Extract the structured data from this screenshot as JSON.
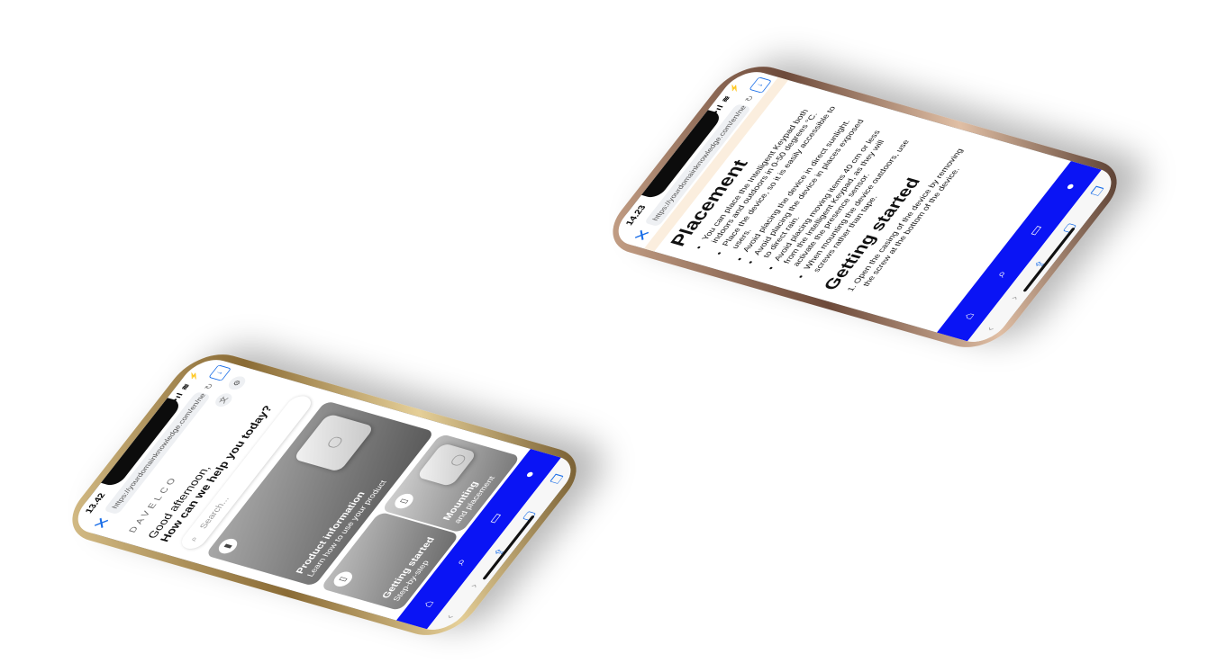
{
  "left_phone": {
    "time": "13.42",
    "status_icons": "•ıl ≋ ⚡",
    "url": "https://yourdomainknowledge.com/en/new-",
    "brand_text": "DAVELCO",
    "greeting_line1": "Good afternoon,",
    "greeting_line2": "How can we help you today?",
    "search_placeholder": "Search...",
    "cards": [
      {
        "title": "Product information",
        "subtitle": "Learn how to use your product"
      },
      {
        "title": "Mounting",
        "subtitle": "and placement"
      },
      {
        "title": "Getting started",
        "subtitle": "Step-by-step"
      }
    ],
    "tabbar_icons": [
      "home-icon",
      "search-icon",
      "chat-icon",
      "user-icon"
    ],
    "toolbar_icons": [
      "back-icon",
      "forward-icon",
      "share-icon",
      "bookmarks-icon",
      "tabs-icon"
    ]
  },
  "right_phone": {
    "time": "14.23",
    "url": "https://yourdomainknowledge.com/en/new-",
    "heading_placement": "Placement",
    "placement_items": [
      "You can place the Intelligent Keypad both indoors and outdoors in 0-50 degrees °C.",
      "Place the device, so it is easily accessible to users.",
      "Avoid placing the device in direct sunlight.",
      "Avoid placing the device in places exposed to direct rain.",
      "Avoid placing moving items 40 cm or less from the Intelligent Keypad, as they will activate the presence sensor.",
      "When mounting the device outdoors, use screws rather than tape."
    ],
    "heading_getting_started": "Getting started",
    "steps": [
      "Open the casing of the device by removing the screw at the bottom of the device."
    ]
  },
  "colors": {
    "accent_blue": "#0a14f5",
    "link_blue": "#1a6ee8",
    "brand_gold": "#e8a100"
  }
}
